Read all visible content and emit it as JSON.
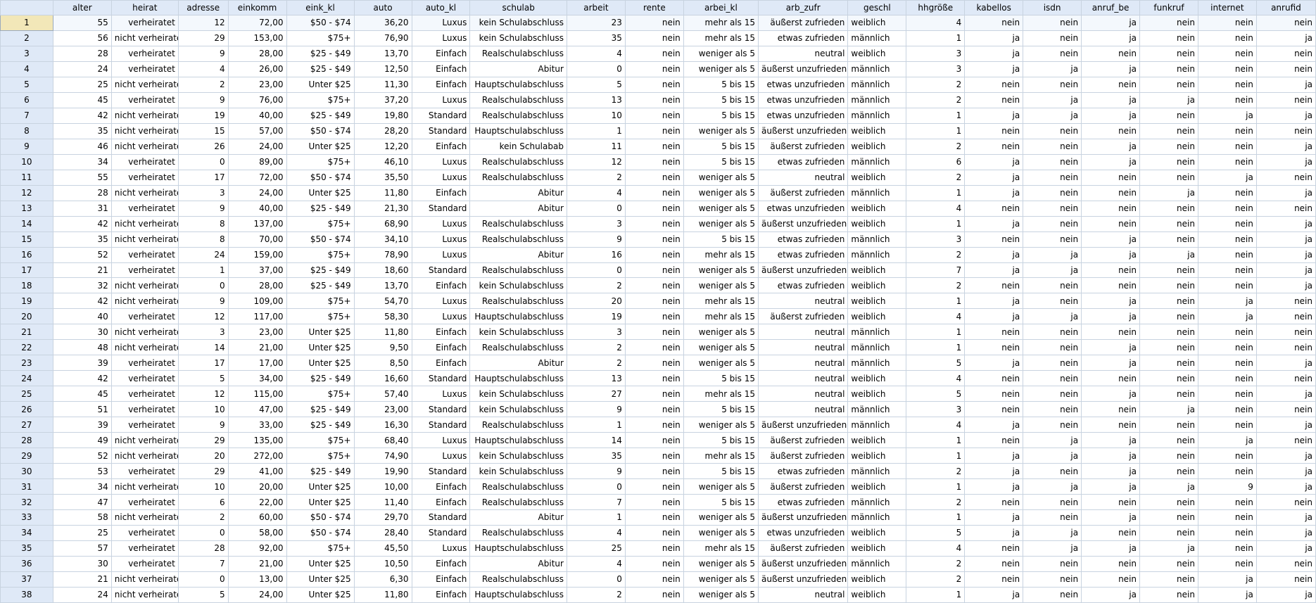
{
  "columns": [
    "alter",
    "heirat",
    "adresse",
    "einkomm",
    "eink_kl",
    "auto",
    "auto_kl",
    "schulab",
    "arbeit",
    "rente",
    "arbei_kl",
    "arb_zufr",
    "geschl",
    "hhgröße",
    "kabellos",
    "isdn",
    "anruf_be",
    "funkruf",
    "internet",
    "anrufid"
  ],
  "rows": [
    [
      "1",
      "55",
      "verheiratet",
      "12",
      "72,00",
      "$50 - $74",
      "36,20",
      "Luxus",
      "kein Schulabschluss",
      "23",
      "nein",
      "mehr als 15",
      "äußerst zufrieden",
      "weiblich",
      "4",
      "nein",
      "nein",
      "ja",
      "nein",
      "nein",
      "nein"
    ],
    [
      "2",
      "56",
      "nicht verheiratet",
      "29",
      "153,00",
      "$75+",
      "76,90",
      "Luxus",
      "kein Schulabschluss",
      "35",
      "nein",
      "mehr als 15",
      "etwas zufrieden",
      "männlich",
      "1",
      "ja",
      "nein",
      "ja",
      "nein",
      "nein",
      "ja"
    ],
    [
      "3",
      "28",
      "verheiratet",
      "9",
      "28,00",
      "$25 - $49",
      "13,70",
      "Einfach",
      "Realschulabschluss",
      "4",
      "nein",
      "weniger als 5",
      "neutral",
      "weiblich",
      "3",
      "ja",
      "nein",
      "nein",
      "nein",
      "nein",
      "nein"
    ],
    [
      "4",
      "24",
      "verheiratet",
      "4",
      "26,00",
      "$25 - $49",
      "12,50",
      "Einfach",
      "Abitur",
      "0",
      "nein",
      "weniger als 5",
      "äußerst unzufrieden",
      "männlich",
      "3",
      "ja",
      "ja",
      "ja",
      "nein",
      "nein",
      "nein"
    ],
    [
      "5",
      "25",
      "nicht verheiratet",
      "2",
      "23,00",
      "Unter $25",
      "11,30",
      "Einfach",
      "Hauptschulabschluss",
      "5",
      "nein",
      "5 bis 15",
      "etwas unzufrieden",
      "männlich",
      "2",
      "nein",
      "nein",
      "nein",
      "nein",
      "nein",
      "ja"
    ],
    [
      "6",
      "45",
      "verheiratet",
      "9",
      "76,00",
      "$75+",
      "37,20",
      "Luxus",
      "Realschulabschluss",
      "13",
      "nein",
      "5 bis 15",
      "etwas unzufrieden",
      "männlich",
      "2",
      "nein",
      "ja",
      "ja",
      "ja",
      "nein",
      "nein"
    ],
    [
      "7",
      "42",
      "nicht verheiratet",
      "19",
      "40,00",
      "$25 - $49",
      "19,80",
      "Standard",
      "Realschulabschluss",
      "10",
      "nein",
      "5 bis 15",
      "etwas unzufrieden",
      "männlich",
      "1",
      "ja",
      "ja",
      "ja",
      "nein",
      "ja",
      "ja"
    ],
    [
      "8",
      "35",
      "nicht verheiratet",
      "15",
      "57,00",
      "$50 - $74",
      "28,20",
      "Standard",
      "Hauptschulabschluss",
      "1",
      "nein",
      "weniger als 5",
      "äußerst unzufrieden",
      "weiblich",
      "1",
      "nein",
      "nein",
      "nein",
      "nein",
      "nein",
      "nein"
    ],
    [
      "9",
      "46",
      "nicht verheiratet",
      "26",
      "24,00",
      "Unter $25",
      "12,20",
      "Einfach",
      "kein Schulabab",
      "11",
      "nein",
      "5 bis 15",
      "äußerst zufrieden",
      "weiblich",
      "2",
      "nein",
      "nein",
      "ja",
      "nein",
      "nein",
      "ja"
    ],
    [
      "10",
      "34",
      "verheiratet",
      "0",
      "89,00",
      "$75+",
      "46,10",
      "Luxus",
      "Realschulabschluss",
      "12",
      "nein",
      "5 bis 15",
      "etwas zufrieden",
      "männlich",
      "6",
      "ja",
      "nein",
      "ja",
      "nein",
      "nein",
      "ja"
    ],
    [
      "11",
      "55",
      "verheiratet",
      "17",
      "72,00",
      "$50 - $74",
      "35,50",
      "Luxus",
      "Realschulabschluss",
      "2",
      "nein",
      "weniger als 5",
      "neutral",
      "weiblich",
      "2",
      "ja",
      "nein",
      "nein",
      "nein",
      "ja",
      "nein"
    ],
    [
      "12",
      "28",
      "nicht verheiratet",
      "3",
      "24,00",
      "Unter $25",
      "11,80",
      "Einfach",
      "Abitur",
      "4",
      "nein",
      "weniger als 5",
      "äußerst zufrieden",
      "männlich",
      "1",
      "ja",
      "nein",
      "nein",
      "ja",
      "nein",
      "ja"
    ],
    [
      "13",
      "31",
      "verheiratet",
      "9",
      "40,00",
      "$25 - $49",
      "21,30",
      "Standard",
      "Abitur",
      "0",
      "nein",
      "weniger als 5",
      "etwas unzufrieden",
      "weiblich",
      "4",
      "nein",
      "nein",
      "nein",
      "nein",
      "nein",
      "nein"
    ],
    [
      "14",
      "42",
      "nicht verheiratet",
      "8",
      "137,00",
      "$75+",
      "68,90",
      "Luxus",
      "Realschulabschluss",
      "3",
      "nein",
      "weniger als 5",
      "äußerst unzufrieden",
      "weiblich",
      "1",
      "ja",
      "nein",
      "nein",
      "nein",
      "nein",
      "ja"
    ],
    [
      "15",
      "35",
      "nicht verheiratet",
      "8",
      "70,00",
      "$50 - $74",
      "34,10",
      "Luxus",
      "Realschulabschluss",
      "9",
      "nein",
      "5 bis 15",
      "etwas zufrieden",
      "männlich",
      "3",
      "nein",
      "nein",
      "ja",
      "nein",
      "nein",
      "ja"
    ],
    [
      "16",
      "52",
      "verheiratet",
      "24",
      "159,00",
      "$75+",
      "78,90",
      "Luxus",
      "Abitur",
      "16",
      "nein",
      "mehr als 15",
      "etwas zufrieden",
      "männlich",
      "2",
      "ja",
      "ja",
      "ja",
      "ja",
      "nein",
      "ja"
    ],
    [
      "17",
      "21",
      "verheiratet",
      "1",
      "37,00",
      "$25 - $49",
      "18,60",
      "Standard",
      "Realschulabschluss",
      "0",
      "nein",
      "weniger als 5",
      "äußerst unzufrieden",
      "weiblich",
      "7",
      "ja",
      "ja",
      "nein",
      "nein",
      "nein",
      "ja"
    ],
    [
      "18",
      "32",
      "nicht verheiratet",
      "0",
      "28,00",
      "$25 - $49",
      "13,70",
      "Einfach",
      "kein Schulabschluss",
      "2",
      "nein",
      "weniger als 5",
      "etwas zufrieden",
      "weiblich",
      "2",
      "nein",
      "nein",
      "nein",
      "nein",
      "nein",
      "ja"
    ],
    [
      "19",
      "42",
      "nicht verheiratet",
      "9",
      "109,00",
      "$75+",
      "54,70",
      "Luxus",
      "Realschulabschluss",
      "20",
      "nein",
      "mehr als 15",
      "neutral",
      "weiblich",
      "1",
      "ja",
      "nein",
      "ja",
      "nein",
      "ja",
      "nein"
    ],
    [
      "20",
      "40",
      "verheiratet",
      "12",
      "117,00",
      "$75+",
      "58,30",
      "Luxus",
      "Hauptschulabschluss",
      "19",
      "nein",
      "mehr als 15",
      "äußerst zufrieden",
      "weiblich",
      "4",
      "ja",
      "ja",
      "ja",
      "nein",
      "ja",
      "nein"
    ],
    [
      "21",
      "30",
      "nicht verheiratet",
      "3",
      "23,00",
      "Unter $25",
      "11,80",
      "Einfach",
      "kein Schulabschluss",
      "3",
      "nein",
      "weniger als 5",
      "neutral",
      "männlich",
      "1",
      "nein",
      "nein",
      "nein",
      "nein",
      "nein",
      "nein"
    ],
    [
      "22",
      "48",
      "nicht verheiratet",
      "14",
      "21,00",
      "Unter $25",
      "9,50",
      "Einfach",
      "Realschulabschluss",
      "2",
      "nein",
      "weniger als 5",
      "neutral",
      "männlich",
      "1",
      "nein",
      "nein",
      "ja",
      "nein",
      "nein",
      "nein"
    ],
    [
      "23",
      "39",
      "verheiratet",
      "17",
      "17,00",
      "Unter $25",
      "8,50",
      "Einfach",
      "Abitur",
      "2",
      "nein",
      "weniger als 5",
      "neutral",
      "männlich",
      "5",
      "ja",
      "nein",
      "ja",
      "nein",
      "nein",
      "ja"
    ],
    [
      "24",
      "42",
      "verheiratet",
      "5",
      "34,00",
      "$25 - $49",
      "16,60",
      "Standard",
      "Hauptschulabschluss",
      "13",
      "nein",
      "5 bis 15",
      "neutral",
      "weiblich",
      "4",
      "nein",
      "nein",
      "nein",
      "nein",
      "nein",
      "nein"
    ],
    [
      "25",
      "45",
      "verheiratet",
      "12",
      "115,00",
      "$75+",
      "57,40",
      "Luxus",
      "kein Schulabschluss",
      "27",
      "nein",
      "mehr als 15",
      "neutral",
      "weiblich",
      "5",
      "nein",
      "nein",
      "ja",
      "nein",
      "nein",
      "ja"
    ],
    [
      "26",
      "51",
      "verheiratet",
      "10",
      "47,00",
      "$25 - $49",
      "23,00",
      "Standard",
      "kein Schulabschluss",
      "9",
      "nein",
      "5 bis 15",
      "neutral",
      "männlich",
      "3",
      "nein",
      "nein",
      "nein",
      "ja",
      "nein",
      "nein"
    ],
    [
      "27",
      "39",
      "verheiratet",
      "9",
      "33,00",
      "$25 - $49",
      "16,30",
      "Standard",
      "Realschulabschluss",
      "1",
      "nein",
      "weniger als 5",
      "äußerst unzufrieden",
      "männlich",
      "4",
      "ja",
      "nein",
      "nein",
      "nein",
      "nein",
      "ja"
    ],
    [
      "28",
      "49",
      "nicht verheiratet",
      "29",
      "135,00",
      "$75+",
      "68,40",
      "Luxus",
      "Hauptschulabschluss",
      "14",
      "nein",
      "5 bis 15",
      "äußerst zufrieden",
      "weiblich",
      "1",
      "nein",
      "ja",
      "ja",
      "nein",
      "ja",
      "nein"
    ],
    [
      "29",
      "52",
      "nicht verheiratet",
      "20",
      "272,00",
      "$75+",
      "74,90",
      "Luxus",
      "kein Schulabschluss",
      "35",
      "nein",
      "mehr als 15",
      "äußerst zufrieden",
      "weiblich",
      "1",
      "ja",
      "ja",
      "ja",
      "nein",
      "nein",
      "ja"
    ],
    [
      "30",
      "53",
      "verheiratet",
      "29",
      "41,00",
      "$25 - $49",
      "19,90",
      "Standard",
      "kein Schulabschluss",
      "9",
      "nein",
      "5 bis 15",
      "etwas zufrieden",
      "männlich",
      "2",
      "ja",
      "nein",
      "ja",
      "nein",
      "nein",
      "ja"
    ],
    [
      "31",
      "34",
      "nicht verheiratet",
      "10",
      "20,00",
      "Unter $25",
      "10,00",
      "Einfach",
      "Realschulabschluss",
      "0",
      "nein",
      "weniger als 5",
      "äußerst zufrieden",
      "weiblich",
      "1",
      "ja",
      "ja",
      "ja",
      "ja",
      "9",
      "ja"
    ],
    [
      "32",
      "47",
      "verheiratet",
      "6",
      "22,00",
      "Unter $25",
      "11,40",
      "Einfach",
      "Realschulabschluss",
      "7",
      "nein",
      "5 bis 15",
      "etwas zufrieden",
      "männlich",
      "2",
      "nein",
      "nein",
      "nein",
      "nein",
      "nein",
      "nein"
    ],
    [
      "33",
      "58",
      "nicht verheiratet",
      "2",
      "60,00",
      "$50 - $74",
      "29,70",
      "Standard",
      "Abitur",
      "1",
      "nein",
      "weniger als 5",
      "äußerst unzufrieden",
      "männlich",
      "1",
      "ja",
      "nein",
      "ja",
      "nein",
      "nein",
      "ja"
    ],
    [
      "34",
      "25",
      "verheiratet",
      "0",
      "58,00",
      "$50 - $74",
      "28,40",
      "Standard",
      "Realschulabschluss",
      "4",
      "nein",
      "weniger als 5",
      "etwas unzufrieden",
      "weiblich",
      "5",
      "ja",
      "ja",
      "nein",
      "nein",
      "nein",
      "ja"
    ],
    [
      "35",
      "57",
      "verheiratet",
      "28",
      "92,00",
      "$75+",
      "45,50",
      "Luxus",
      "Hauptschulabschluss",
      "25",
      "nein",
      "mehr als 15",
      "äußerst zufrieden",
      "weiblich",
      "4",
      "nein",
      "ja",
      "ja",
      "ja",
      "nein",
      "ja"
    ],
    [
      "36",
      "30",
      "verheiratet",
      "7",
      "21,00",
      "Unter $25",
      "10,50",
      "Einfach",
      "Abitur",
      "4",
      "nein",
      "weniger als 5",
      "äußerst unzufrieden",
      "männlich",
      "2",
      "nein",
      "nein",
      "nein",
      "nein",
      "nein",
      "nein"
    ],
    [
      "37",
      "21",
      "nicht verheiratet",
      "0",
      "13,00",
      "Unter $25",
      "6,30",
      "Einfach",
      "Realschulabschluss",
      "0",
      "nein",
      "weniger als 5",
      "äußerst unzufrieden",
      "weiblich",
      "2",
      "nein",
      "nein",
      "nein",
      "nein",
      "ja",
      "nein"
    ],
    [
      "38",
      "24",
      "nicht verheiratet",
      "5",
      "24,00",
      "Unter $25",
      "11,80",
      "Einfach",
      "Hauptschulabschluss",
      "2",
      "nein",
      "weniger als 5",
      "neutral",
      "weiblich",
      "1",
      "ja",
      "nein",
      "ja",
      "nein",
      "ja",
      "ja"
    ]
  ]
}
